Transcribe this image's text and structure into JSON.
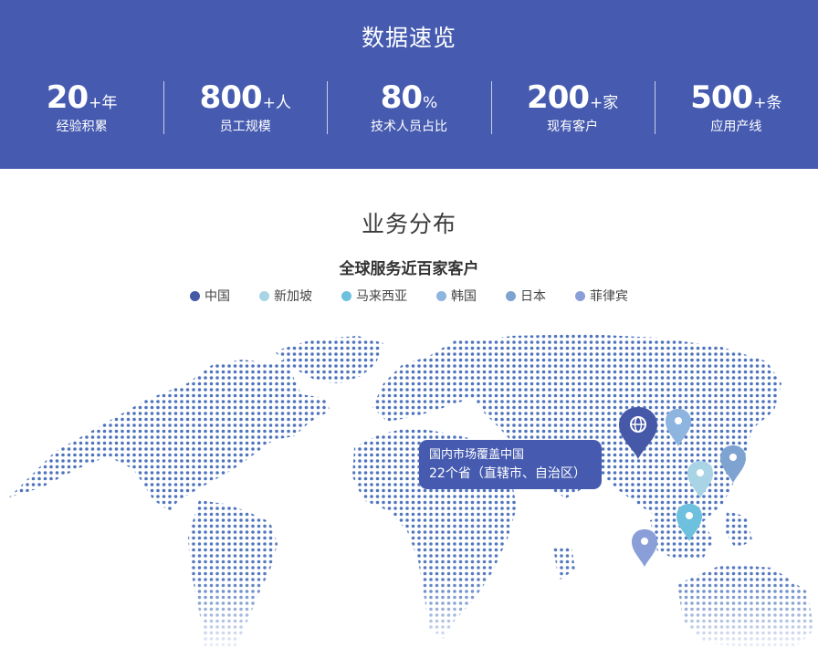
{
  "stats": {
    "title": "数据速览",
    "items": [
      {
        "number": "20",
        "unit": "+年",
        "label": "经验积累"
      },
      {
        "number": "800",
        "unit": "+人",
        "label": "员工规模"
      },
      {
        "number": "80",
        "unit": "%",
        "label": "技术人员占比"
      },
      {
        "number": "200",
        "unit": "+家",
        "label": "现有客户"
      },
      {
        "number": "500",
        "unit": "+条",
        "label": "应用产线"
      }
    ]
  },
  "business": {
    "title": "业务分布",
    "subtitle": "全球服务近百家客户",
    "legend": [
      {
        "label": "中国",
        "color": "#4658a8"
      },
      {
        "label": "新加坡",
        "color": "#a8d4e6"
      },
      {
        "label": "马来西亚",
        "color": "#6ec1de"
      },
      {
        "label": "韩国",
        "color": "#8eb4e0"
      },
      {
        "label": "日本",
        "color": "#7fa3d0"
      },
      {
        "label": "菲律宾",
        "color": "#8a9fd8"
      }
    ]
  },
  "tooltip": {
    "line1": "国内市场覆盖中国",
    "line2": "22个省（直辖市、自治区）"
  },
  "map_icons": {
    "pin": "map-pin-icon",
    "china_marker": "globe-icon"
  }
}
